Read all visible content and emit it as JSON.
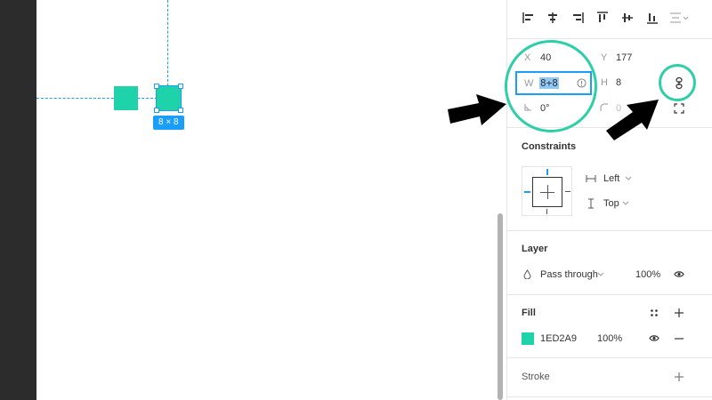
{
  "canvas": {
    "selection_size_badge": "8 × 8",
    "fill_color": "#1ED2A9",
    "accent_color": "#1A9EF7"
  },
  "properties": {
    "x_label": "X",
    "x_value": "40",
    "y_label": "Y",
    "y_value": "177",
    "w_label": "W",
    "w_value": "8+8",
    "h_label": "H",
    "h_value": "8",
    "rotation_value": "0°",
    "corner_radius_value": "0"
  },
  "constraints": {
    "title": "Constraints",
    "horizontal": "Left",
    "vertical": "Top"
  },
  "layer": {
    "title": "Layer",
    "blend_mode": "Pass through",
    "opacity": "100%"
  },
  "fill": {
    "title": "Fill",
    "hex": "1ED2A9",
    "opacity": "100%",
    "swatch_color": "#1ED2A9"
  },
  "stroke": {
    "title": "Stroke"
  },
  "annotations": {
    "circle_color": "#2ECFA8",
    "arrow_color": "#000000"
  }
}
